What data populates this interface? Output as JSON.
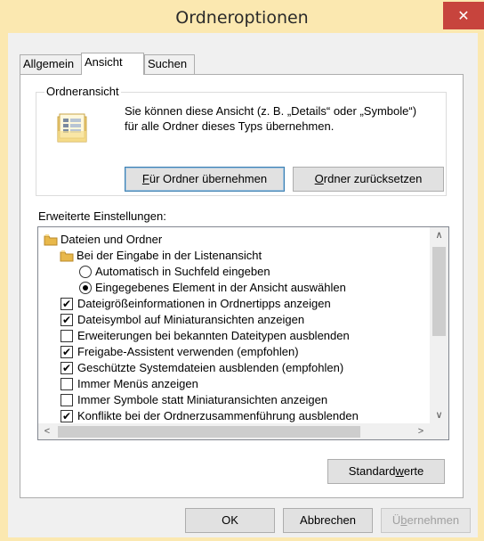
{
  "window": {
    "title": "Ordneroptionen",
    "close_glyph": "✕",
    "colors": {
      "frame": "#fbe8b0",
      "close": "#c7443d",
      "accent": "#3c7fb1"
    }
  },
  "tabs": [
    {
      "label": "Allgemein",
      "active": false
    },
    {
      "label": "Ansicht",
      "active": true
    },
    {
      "label": "Suchen",
      "active": false
    }
  ],
  "folder_view": {
    "legend": "Ordneransicht",
    "description_line1": "Sie können diese Ansicht (z. B. „Details“ oder „Symbole“)",
    "description_line2": "für alle Ordner dieses Typs übernehmen.",
    "icon": "folder-view-icon",
    "apply_button": {
      "mnemonic": "F",
      "rest": "ür Ordner übernehmen"
    },
    "reset_button": {
      "mnemonic": "O",
      "rest": "rdner zurücksetzen"
    }
  },
  "advanced": {
    "label": "Erweiterte Einstellungen:",
    "items": [
      {
        "type": "folder",
        "label": "Dateien und Ordner",
        "level": 0
      },
      {
        "type": "folder",
        "label": "Bei der Eingabe in der Listenansicht",
        "level": 1
      },
      {
        "type": "radio",
        "label": "Automatisch in Suchfeld eingeben",
        "checked": false
      },
      {
        "type": "radio",
        "label": "Eingegebenes Element in der Ansicht auswählen",
        "checked": true
      },
      {
        "type": "checkbox",
        "label": "Dateigrößeinformationen in Ordnertipps anzeigen",
        "checked": true
      },
      {
        "type": "checkbox",
        "label": "Dateisymbol auf Miniaturansichten anzeigen",
        "checked": true
      },
      {
        "type": "checkbox",
        "label": "Erweiterungen bei bekannten Dateitypen ausblenden",
        "checked": false
      },
      {
        "type": "checkbox",
        "label": "Freigabe-Assistent verwenden (empfohlen)",
        "checked": true
      },
      {
        "type": "checkbox",
        "label": "Geschützte Systemdateien ausblenden (empfohlen)",
        "checked": true
      },
      {
        "type": "checkbox",
        "label": "Immer Menüs anzeigen",
        "checked": false
      },
      {
        "type": "checkbox",
        "label": "Immer Symbole statt Miniaturansichten anzeigen",
        "checked": false
      },
      {
        "type": "checkbox",
        "label": "Konflikte bei der Ordnerzusammenführung ausblenden",
        "checked": true
      }
    ],
    "check_glyph": "✔",
    "scroll_up": "∧",
    "scroll_down": "∨",
    "scroll_left": "<",
    "scroll_right": ">"
  },
  "defaults_button": {
    "pre": "Standard",
    "mnemonic": "w",
    "post": "erte"
  },
  "footer": {
    "ok": "OK",
    "cancel": "Abbrechen",
    "apply": {
      "pre": "Ü",
      "mnemonic": "b",
      "post": "ernehmen"
    }
  }
}
